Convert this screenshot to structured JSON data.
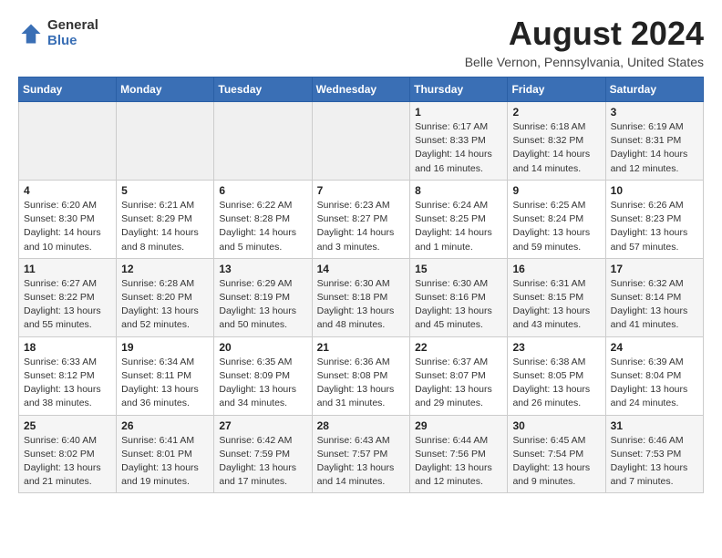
{
  "logo": {
    "general": "General",
    "blue": "Blue"
  },
  "title": "August 2024",
  "location": "Belle Vernon, Pennsylvania, United States",
  "weekdays": [
    "Sunday",
    "Monday",
    "Tuesday",
    "Wednesday",
    "Thursday",
    "Friday",
    "Saturday"
  ],
  "weeks": [
    [
      {
        "day": "",
        "detail": ""
      },
      {
        "day": "",
        "detail": ""
      },
      {
        "day": "",
        "detail": ""
      },
      {
        "day": "",
        "detail": ""
      },
      {
        "day": "1",
        "detail": "Sunrise: 6:17 AM\nSunset: 8:33 PM\nDaylight: 14 hours\nand 16 minutes."
      },
      {
        "day": "2",
        "detail": "Sunrise: 6:18 AM\nSunset: 8:32 PM\nDaylight: 14 hours\nand 14 minutes."
      },
      {
        "day": "3",
        "detail": "Sunrise: 6:19 AM\nSunset: 8:31 PM\nDaylight: 14 hours\nand 12 minutes."
      }
    ],
    [
      {
        "day": "4",
        "detail": "Sunrise: 6:20 AM\nSunset: 8:30 PM\nDaylight: 14 hours\nand 10 minutes."
      },
      {
        "day": "5",
        "detail": "Sunrise: 6:21 AM\nSunset: 8:29 PM\nDaylight: 14 hours\nand 8 minutes."
      },
      {
        "day": "6",
        "detail": "Sunrise: 6:22 AM\nSunset: 8:28 PM\nDaylight: 14 hours\nand 5 minutes."
      },
      {
        "day": "7",
        "detail": "Sunrise: 6:23 AM\nSunset: 8:27 PM\nDaylight: 14 hours\nand 3 minutes."
      },
      {
        "day": "8",
        "detail": "Sunrise: 6:24 AM\nSunset: 8:25 PM\nDaylight: 14 hours\nand 1 minute."
      },
      {
        "day": "9",
        "detail": "Sunrise: 6:25 AM\nSunset: 8:24 PM\nDaylight: 13 hours\nand 59 minutes."
      },
      {
        "day": "10",
        "detail": "Sunrise: 6:26 AM\nSunset: 8:23 PM\nDaylight: 13 hours\nand 57 minutes."
      }
    ],
    [
      {
        "day": "11",
        "detail": "Sunrise: 6:27 AM\nSunset: 8:22 PM\nDaylight: 13 hours\nand 55 minutes."
      },
      {
        "day": "12",
        "detail": "Sunrise: 6:28 AM\nSunset: 8:20 PM\nDaylight: 13 hours\nand 52 minutes."
      },
      {
        "day": "13",
        "detail": "Sunrise: 6:29 AM\nSunset: 8:19 PM\nDaylight: 13 hours\nand 50 minutes."
      },
      {
        "day": "14",
        "detail": "Sunrise: 6:30 AM\nSunset: 8:18 PM\nDaylight: 13 hours\nand 48 minutes."
      },
      {
        "day": "15",
        "detail": "Sunrise: 6:30 AM\nSunset: 8:16 PM\nDaylight: 13 hours\nand 45 minutes."
      },
      {
        "day": "16",
        "detail": "Sunrise: 6:31 AM\nSunset: 8:15 PM\nDaylight: 13 hours\nand 43 minutes."
      },
      {
        "day": "17",
        "detail": "Sunrise: 6:32 AM\nSunset: 8:14 PM\nDaylight: 13 hours\nand 41 minutes."
      }
    ],
    [
      {
        "day": "18",
        "detail": "Sunrise: 6:33 AM\nSunset: 8:12 PM\nDaylight: 13 hours\nand 38 minutes."
      },
      {
        "day": "19",
        "detail": "Sunrise: 6:34 AM\nSunset: 8:11 PM\nDaylight: 13 hours\nand 36 minutes."
      },
      {
        "day": "20",
        "detail": "Sunrise: 6:35 AM\nSunset: 8:09 PM\nDaylight: 13 hours\nand 34 minutes."
      },
      {
        "day": "21",
        "detail": "Sunrise: 6:36 AM\nSunset: 8:08 PM\nDaylight: 13 hours\nand 31 minutes."
      },
      {
        "day": "22",
        "detail": "Sunrise: 6:37 AM\nSunset: 8:07 PM\nDaylight: 13 hours\nand 29 minutes."
      },
      {
        "day": "23",
        "detail": "Sunrise: 6:38 AM\nSunset: 8:05 PM\nDaylight: 13 hours\nand 26 minutes."
      },
      {
        "day": "24",
        "detail": "Sunrise: 6:39 AM\nSunset: 8:04 PM\nDaylight: 13 hours\nand 24 minutes."
      }
    ],
    [
      {
        "day": "25",
        "detail": "Sunrise: 6:40 AM\nSunset: 8:02 PM\nDaylight: 13 hours\nand 21 minutes."
      },
      {
        "day": "26",
        "detail": "Sunrise: 6:41 AM\nSunset: 8:01 PM\nDaylight: 13 hours\nand 19 minutes."
      },
      {
        "day": "27",
        "detail": "Sunrise: 6:42 AM\nSunset: 7:59 PM\nDaylight: 13 hours\nand 17 minutes."
      },
      {
        "day": "28",
        "detail": "Sunrise: 6:43 AM\nSunset: 7:57 PM\nDaylight: 13 hours\nand 14 minutes."
      },
      {
        "day": "29",
        "detail": "Sunrise: 6:44 AM\nSunset: 7:56 PM\nDaylight: 13 hours\nand 12 minutes."
      },
      {
        "day": "30",
        "detail": "Sunrise: 6:45 AM\nSunset: 7:54 PM\nDaylight: 13 hours\nand 9 minutes."
      },
      {
        "day": "31",
        "detail": "Sunrise: 6:46 AM\nSunset: 7:53 PM\nDaylight: 13 hours\nand 7 minutes."
      }
    ]
  ]
}
